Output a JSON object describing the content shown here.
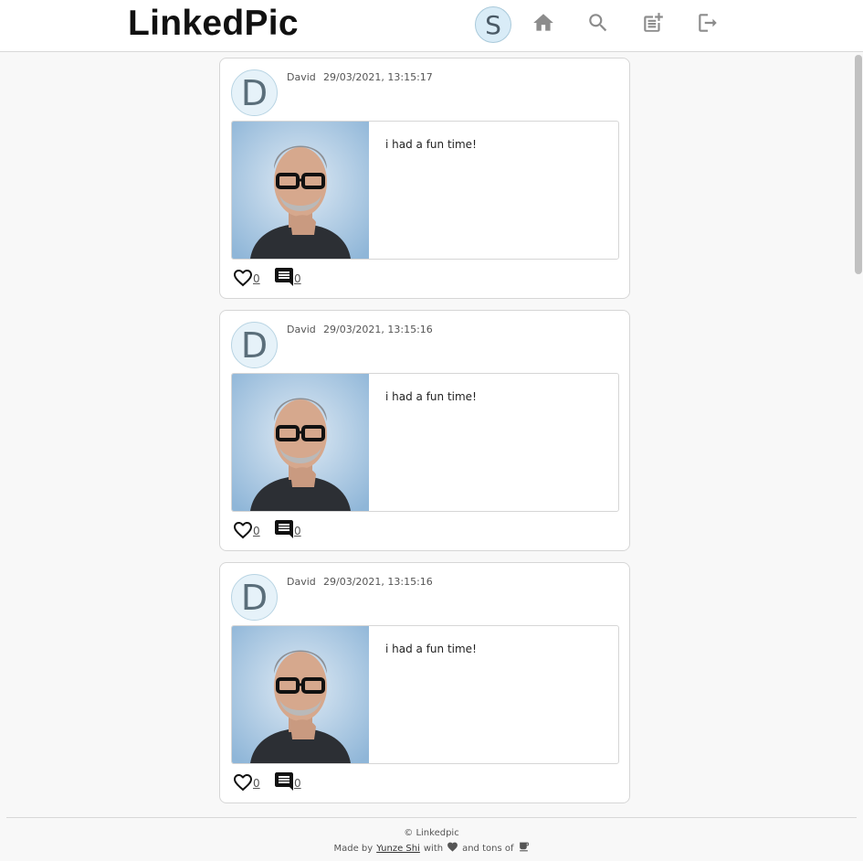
{
  "app": {
    "logo": "LinkedPic",
    "user_initial": "S"
  },
  "nav": {
    "icons": [
      "home-icon",
      "search-icon",
      "new-post-icon",
      "logout-icon"
    ]
  },
  "posts": [
    {
      "initial": "D",
      "author": "David",
      "time": "29/03/2021, 13:15:17",
      "caption": "i had a fun time!",
      "likes": "0",
      "comments": "0"
    },
    {
      "initial": "D",
      "author": "David",
      "time": "29/03/2021, 13:15:16",
      "caption": "i had a fun time!",
      "likes": "0",
      "comments": "0"
    },
    {
      "initial": "D",
      "author": "David",
      "time": "29/03/2021, 13:15:16",
      "caption": "i had a fun time!",
      "likes": "0",
      "comments": "0"
    }
  ],
  "footer": {
    "copyright": "© Linkedpic",
    "made_by": "Made by",
    "author": "Yunze Shi",
    "with": "with",
    "and_tons_of": "and tons of"
  },
  "colors": {
    "accent": "#d9ecf7",
    "icon": "#8c8c8c"
  }
}
